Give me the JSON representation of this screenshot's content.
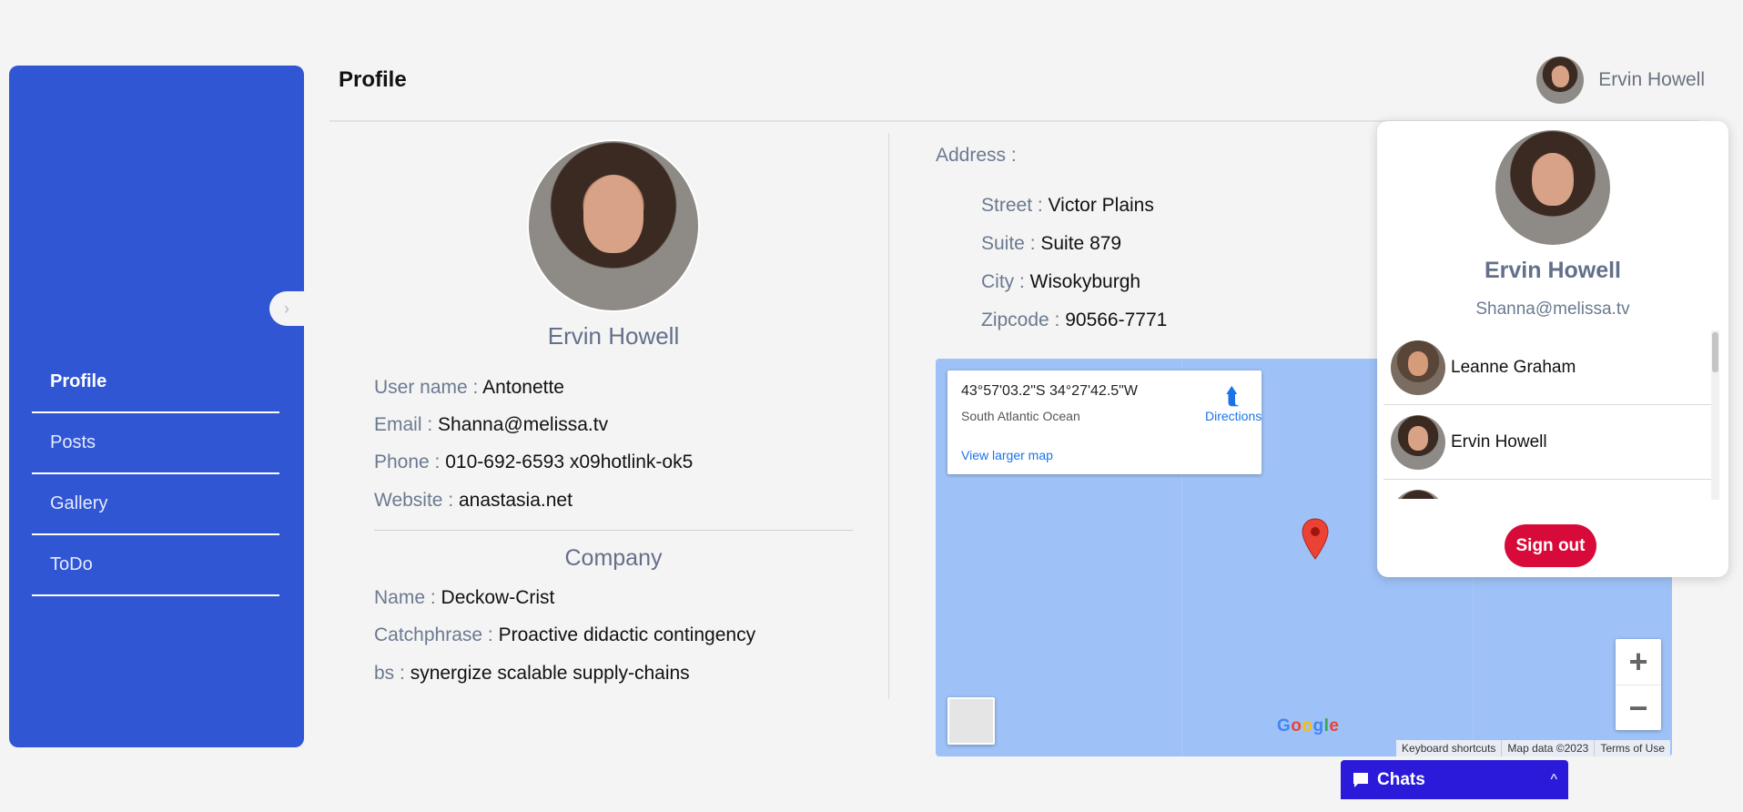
{
  "sidebar": {
    "items": [
      {
        "label": "Profile",
        "active": true
      },
      {
        "label": "Posts"
      },
      {
        "label": "Gallery"
      },
      {
        "label": "ToDo"
      }
    ],
    "collapse_icon": "chevron-right-icon"
  },
  "header": {
    "title": "Profile",
    "user_name": "Ervin Howell"
  },
  "profile": {
    "name": "Ervin Howell",
    "fields": [
      {
        "label": "User name : ",
        "value": "Antonette"
      },
      {
        "label": "Email : ",
        "value": "Shanna@melissa.tv"
      },
      {
        "label": "Phone : ",
        "value": "010-692-6593 x09hotlink-ok5"
      },
      {
        "label": "Website : ",
        "value": "anastasia.net"
      }
    ],
    "company_title": "Company",
    "company": [
      {
        "label": "Name : ",
        "value": "Deckow-Crist"
      },
      {
        "label": "Catchphrase : ",
        "value": "Proactive didactic contingency"
      },
      {
        "label": "bs : ",
        "value": "synergize scalable supply-chains"
      }
    ]
  },
  "address": {
    "title": "Address :",
    "fields": [
      {
        "label": "Street : ",
        "value": "Victor Plains"
      },
      {
        "label": "Suite : ",
        "value": "Suite 879"
      },
      {
        "label": "City : ",
        "value": "Wisokyburgh"
      },
      {
        "label": "Zipcode : ",
        "value": "90566-7771"
      }
    ]
  },
  "map": {
    "coords": "43°57'03.2\"S 34°27'42.5\"W",
    "place": "South Atlantic Ocean",
    "directions": "Directions",
    "larger_map": "View larger map",
    "zoom_in": "+",
    "zoom_out": "−",
    "logo": "Google",
    "attribution": [
      "Keyboard shortcuts",
      "Map data ©2023",
      "Terms of Use"
    ],
    "background_color": "#9ec2f7"
  },
  "popup": {
    "name": "Ervin Howell",
    "email": "Shanna@melissa.tv",
    "users": [
      "Leanne Graham",
      "Ervin Howell",
      ""
    ],
    "signout": "Sign out"
  },
  "chat": {
    "title": "Chats",
    "icon": "chat-bubble-icon",
    "chevron": "^"
  },
  "colors": {
    "sidebar": "#3056d3",
    "signout": "#d80a3a",
    "chatbar": "#2b1ad9",
    "label": "#6b7a90"
  }
}
